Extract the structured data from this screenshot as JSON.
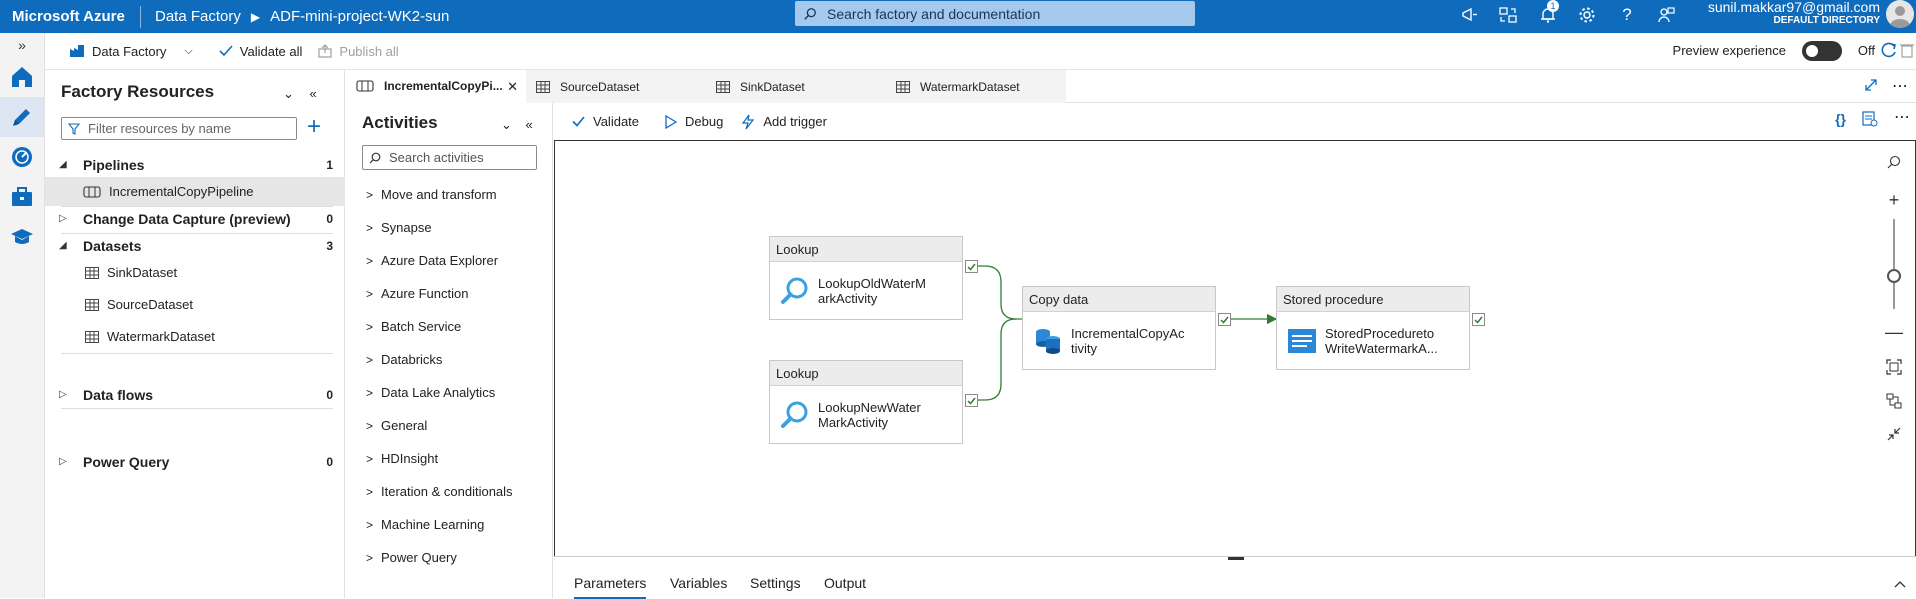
{
  "topbar": {
    "brand": "Microsoft Azure",
    "breadcrumb": [
      "Data Factory",
      "ADF-mini-project-WK2-sun"
    ],
    "search_placeholder": "Search factory and documentation",
    "notification_count": "1",
    "user_email": "sunil.makkar97@gmail.com",
    "user_directory": "DEFAULT DIRECTORY"
  },
  "toolbar": {
    "data_factory": "Data Factory",
    "validate_all": "Validate all",
    "publish_all": "Publish all",
    "preview_experience": "Preview experience",
    "toggle_state": "Off"
  },
  "resources": {
    "title": "Factory Resources",
    "filter_placeholder": "Filter resources by name",
    "groups": [
      {
        "name": "Pipelines",
        "count": "1",
        "expanded": true,
        "children": [
          "IncrementalCopyPipeline"
        ]
      },
      {
        "name": "Change Data Capture (preview)",
        "count": "0",
        "expanded": false,
        "children": []
      },
      {
        "name": "Datasets",
        "count": "3",
        "expanded": true,
        "children": [
          "SinkDataset",
          "SourceDataset",
          "WatermarkDataset"
        ]
      },
      {
        "name": "Data flows",
        "count": "0",
        "expanded": false,
        "children": []
      },
      {
        "name": "Power Query",
        "count": "0",
        "expanded": false,
        "children": []
      }
    ]
  },
  "tabs": [
    {
      "label": "IncrementalCopyPi...",
      "active": true
    },
    {
      "label": "SourceDataset",
      "active": false
    },
    {
      "label": "SinkDataset",
      "active": false
    },
    {
      "label": "WatermarkDataset",
      "active": false
    }
  ],
  "activities": {
    "title": "Activities",
    "search_placeholder": "Search activities",
    "items": [
      "Move and transform",
      "Synapse",
      "Azure Data Explorer",
      "Azure Function",
      "Batch Service",
      "Databricks",
      "Data Lake Analytics",
      "General",
      "HDInsight",
      "Iteration & conditionals",
      "Machine Learning",
      "Power Query"
    ]
  },
  "canvas_toolbar": {
    "validate": "Validate",
    "debug": "Debug",
    "add_trigger": "Add trigger"
  },
  "nodes": [
    {
      "type": "Lookup",
      "name": "LookupOldWaterMarkActivity",
      "line1": "LookupOldWaterM",
      "line2": "arkActivity",
      "icon": "search-icon"
    },
    {
      "type": "Lookup",
      "name": "LookupNewWaterMarkActivity",
      "line1": "LookupNewWater",
      "line2": "MarkActivity",
      "icon": "search-icon"
    },
    {
      "type": "Copy data",
      "name": "IncrementalCopyActivity",
      "line1": "IncrementalCopyAc",
      "line2": "tivity",
      "icon": "database-icon"
    },
    {
      "type": "Stored procedure",
      "name": "StoredProceduretoWriteWatermarkActivity",
      "line1": "StoredProcedureto",
      "line2": "WriteWatermarkA...",
      "icon": "stored-procedure-icon"
    }
  ],
  "bottom_tabs": [
    "Parameters",
    "Variables",
    "Settings",
    "Output"
  ],
  "colors": {
    "azure_blue": "#0f6cbd",
    "success_green": "#2e7d32"
  }
}
